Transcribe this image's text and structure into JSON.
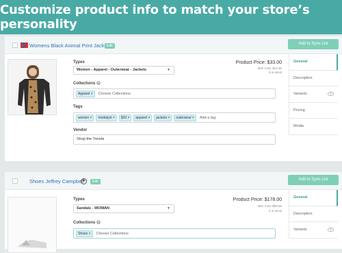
{
  "header": {
    "title": "Customize product info to match your store’s personality"
  },
  "products": [
    {
      "title": "Womens Black Animal Print Jacket",
      "edit_label": "Edit",
      "sync_label": "Add to Sync List",
      "types_label": "Types",
      "type_value": "Women - Apparel - Outerwear - Jackets",
      "collections_label": "Collections",
      "collections": [
        "Apparel"
      ],
      "collections_placeholder": "Choose Collections",
      "tags_label": "Tags",
      "tags": [
        "women",
        "modalyst",
        "$20",
        "apparel",
        "jackets",
        "outerwear"
      ],
      "tags_placeholder": "Add a tag",
      "vendor_label": "Vendor",
      "vendor_value": "Shop the Trends",
      "price": "Product Price: $33.00",
      "item_cost": "Item Cost: $14.00",
      "stock": "8 in stock"
    },
    {
      "title": "Shoes Jeffrey Campbell",
      "edit_label": "Edit",
      "sync_label": "Add to Sync List",
      "types_label": "Types",
      "type_value": "Sandals - WOMAN",
      "collections_label": "Collections",
      "collections": [
        "Shoes"
      ],
      "collections_placeholder": "Choose Collections",
      "price": "Product Price: $178.00",
      "item_cost": "Item Cost: $89.00",
      "stock": "2 in stock"
    }
  ],
  "tabs": [
    "General",
    "Description",
    "Variants",
    "Pricing",
    "Media"
  ],
  "variants_count": "3",
  "tags_remove": "×",
  "icons": {
    "checkbox": "checkbox-icon",
    "flag": "product-flag-icon",
    "star": "star-icon",
    "help": "help-icon",
    "chevron": "chevron-down-icon"
  },
  "colors": {
    "header": "#49aaa5",
    "button": "#7fcfb8",
    "active_tab": "#3b9a7a",
    "link": "#2a73b8"
  }
}
